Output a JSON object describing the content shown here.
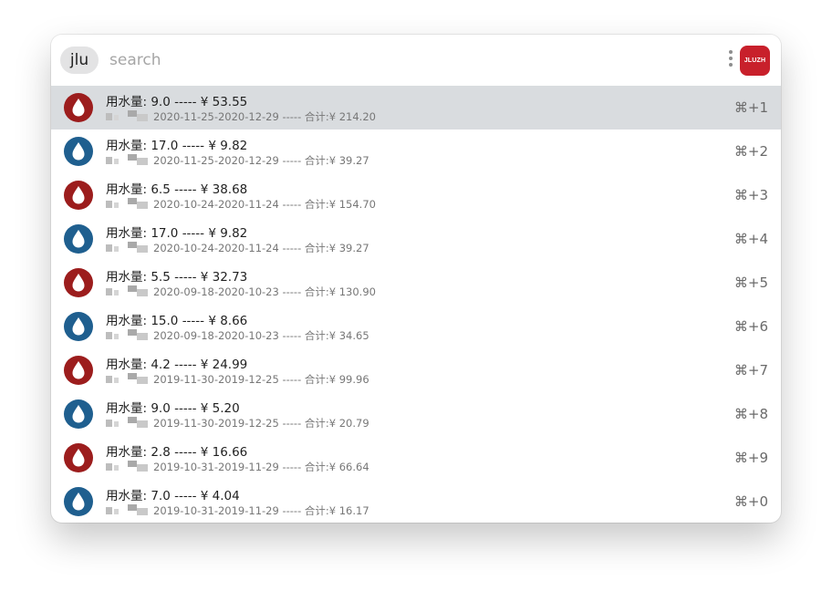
{
  "search": {
    "keyword": "jlu",
    "placeholder": "search"
  },
  "app": {
    "logo_text": "JLUZH",
    "logo_color": "#c8202b"
  },
  "icons": {
    "more": "vertical-ellipsis-icon",
    "result": "water-drop-icon"
  },
  "colors": {
    "drop_red": "#9c1d1d",
    "drop_blue": "#1f5f8f",
    "selected_row": "#d9dcdf"
  },
  "results": [
    {
      "title": "用水量: 9.0 ----- ¥ 53.55",
      "detail": "2020-11-25-2020-12-29 ----- 合计:¥ 214.20",
      "shortcut": "⌘+1",
      "icon_color": "red",
      "selected": true
    },
    {
      "title": "用水量: 17.0 ----- ¥ 9.82",
      "detail": "2020-11-25-2020-12-29 ----- 合计:¥ 39.27",
      "shortcut": "⌘+2",
      "icon_color": "blue",
      "selected": false
    },
    {
      "title": "用水量: 6.5 ----- ¥ 38.68",
      "detail": "2020-10-24-2020-11-24 ----- 合计:¥ 154.70",
      "shortcut": "⌘+3",
      "icon_color": "red",
      "selected": false
    },
    {
      "title": "用水量: 17.0 ----- ¥ 9.82",
      "detail": "2020-10-24-2020-11-24 ----- 合计:¥ 39.27",
      "shortcut": "⌘+4",
      "icon_color": "blue",
      "selected": false
    },
    {
      "title": "用水量: 5.5 ----- ¥ 32.73",
      "detail": "2020-09-18-2020-10-23 ----- 合计:¥ 130.90",
      "shortcut": "⌘+5",
      "icon_color": "red",
      "selected": false
    },
    {
      "title": "用水量: 15.0 ----- ¥ 8.66",
      "detail": "2020-09-18-2020-10-23 ----- 合计:¥ 34.65",
      "shortcut": "⌘+6",
      "icon_color": "blue",
      "selected": false
    },
    {
      "title": "用水量: 4.2 ----- ¥ 24.99",
      "detail": "2019-11-30-2019-12-25 ----- 合计:¥ 99.96",
      "shortcut": "⌘+7",
      "icon_color": "red",
      "selected": false
    },
    {
      "title": "用水量: 9.0 ----- ¥ 5.20",
      "detail": "2019-11-30-2019-12-25 ----- 合计:¥ 20.79",
      "shortcut": "⌘+8",
      "icon_color": "blue",
      "selected": false
    },
    {
      "title": "用水量: 2.8 ----- ¥ 16.66",
      "detail": "2019-10-31-2019-11-29 ----- 合计:¥ 66.64",
      "shortcut": "⌘+9",
      "icon_color": "red",
      "selected": false
    },
    {
      "title": "用水量: 7.0 ----- ¥ 4.04",
      "detail": "2019-10-31-2019-11-29 ----- 合计:¥ 16.17",
      "shortcut": "⌘+0",
      "icon_color": "blue",
      "selected": false
    }
  ]
}
